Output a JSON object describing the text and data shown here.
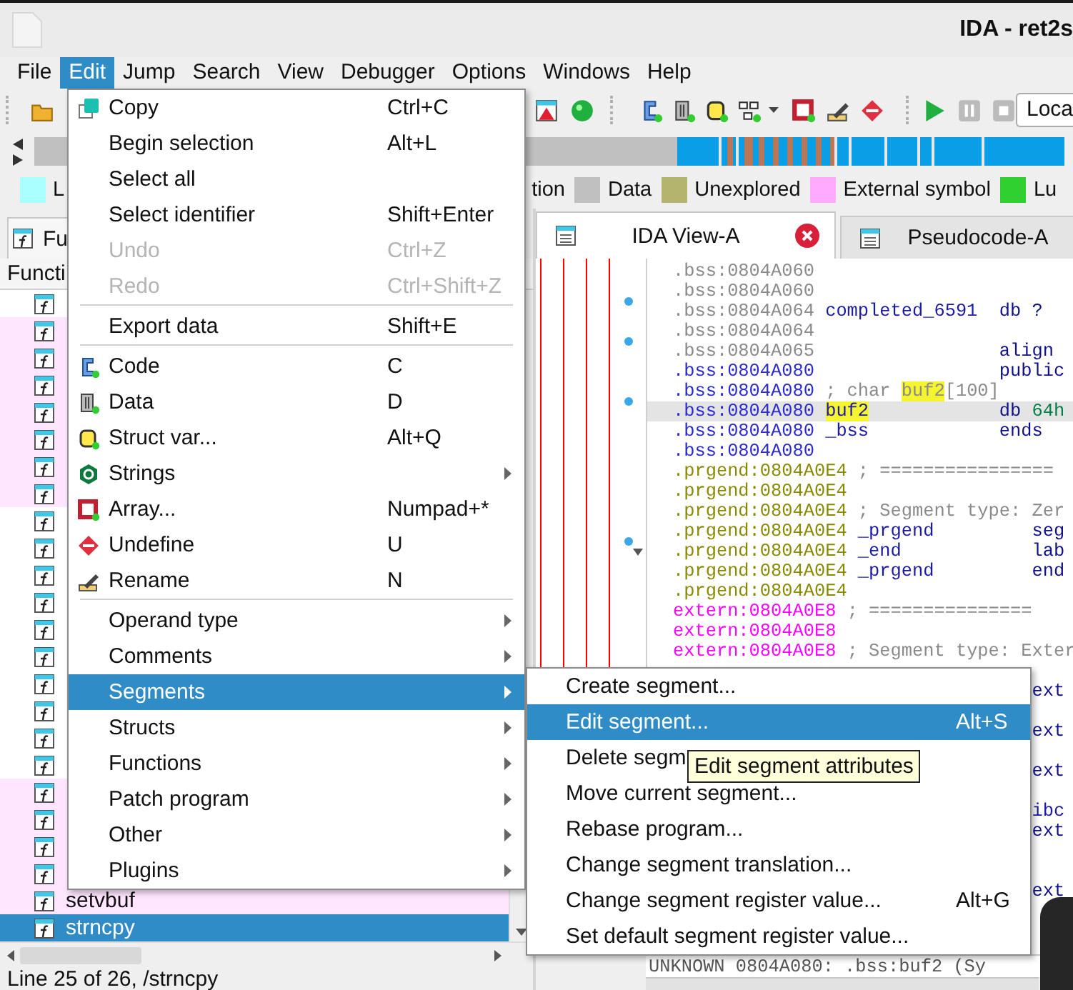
{
  "window": {
    "title": "IDA - ret2s"
  },
  "menubar": [
    {
      "label": "File",
      "selected": false
    },
    {
      "label": "Edit",
      "selected": true
    },
    {
      "label": "Jump",
      "selected": false
    },
    {
      "label": "Search",
      "selected": false
    },
    {
      "label": "View",
      "selected": false
    },
    {
      "label": "Debugger",
      "selected": false
    },
    {
      "label": "Options",
      "selected": false
    },
    {
      "label": "Windows",
      "selected": false
    },
    {
      "label": "Help",
      "selected": false
    }
  ],
  "toolbar": {
    "debugger_select": "Loca"
  },
  "legend": [
    {
      "label": "L",
      "color": "#aaffff"
    },
    {
      "label": "tion"
    },
    {
      "label": "Data",
      "color": "#c0c0c0"
    },
    {
      "label": "Unexplored",
      "color": "#b4b46e"
    },
    {
      "label": "External symbol",
      "color": "#ffaaff"
    },
    {
      "label": "Lu",
      "color": "#30d030"
    }
  ],
  "functions_panel": {
    "tab": "Fu",
    "header": "Functi",
    "status": "Line 25 of 26, /strncpy",
    "rows": [
      {
        "imported": false,
        "selected": false
      },
      {
        "imported": true,
        "selected": false
      },
      {
        "imported": true,
        "selected": false
      },
      {
        "imported": true,
        "selected": false
      },
      {
        "imported": true,
        "selected": false
      },
      {
        "imported": true,
        "selected": false
      },
      {
        "imported": true,
        "selected": false
      },
      {
        "imported": true,
        "selected": false
      },
      {
        "imported": false,
        "selected": false
      },
      {
        "imported": false,
        "selected": false
      },
      {
        "imported": false,
        "selected": false
      },
      {
        "imported": false,
        "selected": false
      },
      {
        "imported": false,
        "selected": false
      },
      {
        "imported": false,
        "selected": false
      },
      {
        "imported": false,
        "selected": false
      },
      {
        "imported": false,
        "selected": false
      },
      {
        "imported": false,
        "selected": false
      },
      {
        "imported": false,
        "selected": false
      },
      {
        "imported": true,
        "selected": false
      },
      {
        "imported": true,
        "selected": false
      },
      {
        "imported": true,
        "selected": false
      },
      {
        "imported": true,
        "selected": false
      },
      {
        "name": "setvbuf",
        "imported": true,
        "selected": false
      },
      {
        "name": "strncpy",
        "imported": true,
        "selected": true
      }
    ]
  },
  "tabs": [
    {
      "label": "IDA View-A",
      "selected": true,
      "closable": true
    },
    {
      "label": "Pseudocode-A",
      "selected": false,
      "closable": false
    }
  ],
  "disassembly": {
    "status": "UNKNOWN 0804A080: .bss:buf2 (Sy",
    "lines": [
      {
        "kind": "bss",
        "address": ".bss:0804A060",
        "color": "#8a8a8a",
        "selected": false,
        "dot": false
      },
      {
        "kind": "bss",
        "address": ".bss:0804A060",
        "color": "#8a8a8a",
        "selected": false,
        "dot": false
      },
      {
        "kind": "bss",
        "address": ".bss:0804A064",
        "color": "#8a8a8a",
        "selected": false,
        "dot": true,
        "tokens": [
          {
            "kind": "label",
            "text": "completed_6591",
            "highlight": false
          },
          {
            "kind": "mnemonic",
            "text": "db",
            "highlight": false
          },
          {
            "kind": "operand",
            "text": "?",
            "highlight": false
          }
        ]
      },
      {
        "kind": "bss",
        "address": ".bss:0804A064",
        "color": "#8a8a8a",
        "selected": false,
        "dot": false
      },
      {
        "kind": "bss",
        "address": ".bss:0804A065",
        "color": "#8a8a8a",
        "selected": false,
        "dot": true,
        "tokens": [
          {
            "kind": "mnemonic",
            "text": "align",
            "highlight": false
          }
        ]
      },
      {
        "kind": "bss",
        "address": ".bss:0804A080",
        "color": "#2a2ad0",
        "selected": false,
        "dot": false,
        "tokens": [
          {
            "kind": "mnemonic",
            "text": "public",
            "highlight": false
          }
        ]
      },
      {
        "kind": "bss",
        "address": ".bss:0804A080",
        "color": "#2a2ad0",
        "selected": false,
        "dot": false,
        "tokens": [
          {
            "kind": "comment",
            "text": "; char ",
            "highlight": false
          },
          {
            "kind": "comment",
            "text": "buf2",
            "highlight": true
          },
          {
            "kind": "comment",
            "text": "[100]",
            "highlight": false
          }
        ]
      },
      {
        "kind": "bss",
        "address": ".bss:0804A080",
        "color": "#2a2ad0",
        "selected": true,
        "dot": true,
        "tokens": [
          {
            "kind": "label",
            "text": "buf2",
            "highlight": true
          },
          {
            "kind": "mnemonic",
            "text": "db",
            "highlight": false
          },
          {
            "kind": "number",
            "text": "64h",
            "highlight": false
          }
        ]
      },
      {
        "kind": "bss",
        "address": ".bss:0804A080",
        "color": "#2a2ad0",
        "selected": false,
        "dot": false,
        "tokens": [
          {
            "kind": "label",
            "text": "_bss",
            "highlight": false
          },
          {
            "kind": "mnemonic",
            "text": "ends",
            "highlight": false
          }
        ]
      },
      {
        "kind": "bss",
        "address": ".bss:0804A080",
        "color": "#2a2ad0",
        "selected": false,
        "dot": false
      },
      {
        "kind": "prgend",
        "address": ".prgend:0804A0E4",
        "color": "#8a8a00",
        "selected": false,
        "dot": false,
        "tokens": [
          {
            "kind": "comment",
            "text": "; ================",
            "highlight": false
          }
        ]
      },
      {
        "kind": "prgend",
        "address": ".prgend:0804A0E4",
        "color": "#8a8a00",
        "selected": false,
        "dot": false
      },
      {
        "kind": "prgend",
        "address": ".prgend:0804A0E4",
        "color": "#8a8a00",
        "selected": false,
        "dot": false,
        "tokens": [
          {
            "kind": "comment",
            "text": "; Segment type: Zer",
            "highlight": false
          }
        ]
      },
      {
        "kind": "prgend",
        "address": ".prgend:0804A0E4",
        "color": "#8a8a00",
        "selected": false,
        "dot": false,
        "tokens": [
          {
            "kind": "label",
            "text": "_prgend",
            "highlight": false
          },
          {
            "kind": "mnemonic",
            "text": "seg",
            "highlight": false
          }
        ]
      },
      {
        "kind": "prgend",
        "address": ".prgend:0804A0E4",
        "color": "#8a8a00",
        "selected": false,
        "dot": true,
        "expanded": true,
        "tokens": [
          {
            "kind": "label",
            "text": "_end",
            "highlight": false
          },
          {
            "kind": "mnemonic",
            "text": "lab",
            "highlight": false
          }
        ]
      },
      {
        "kind": "prgend",
        "address": ".prgend:0804A0E4",
        "color": "#8a8a00",
        "selected": false,
        "dot": false,
        "tokens": [
          {
            "kind": "label",
            "text": "_prgend",
            "highlight": false
          },
          {
            "kind": "mnemonic",
            "text": "end",
            "highlight": false
          }
        ]
      },
      {
        "kind": "prgend",
        "address": ".prgend:0804A0E4",
        "color": "#8a8a00",
        "selected": false,
        "dot": false
      },
      {
        "kind": "extern",
        "address": "extern:0804A0E8",
        "color": "#ff00ff",
        "selected": false,
        "dot": false,
        "tokens": [
          {
            "kind": "comment",
            "text": "; ===============",
            "highlight": false
          }
        ]
      },
      {
        "kind": "extern",
        "address": "extern:0804A0E8",
        "color": "#ff00ff",
        "selected": false,
        "dot": false
      },
      {
        "kind": "extern",
        "address": "extern:0804A0E8",
        "color": "#ff00ff",
        "selected": false,
        "dot": false,
        "tokens": [
          {
            "kind": "comment",
            "text": "; Segment type: Exter",
            "highlight": false
          }
        ]
      },
      {
        "kind": "extern",
        "selected": false
      },
      {
        "kind": "extern",
        "selected": false,
        "tokens": [
          {
            "kind": "mnemonic",
            "text": "ext",
            "highlight": false
          }
        ]
      },
      {
        "kind": "extern",
        "selected": false
      },
      {
        "kind": "extern",
        "selected": false,
        "tokens": [
          {
            "kind": "mnemonic",
            "text": "ext",
            "highlight": false
          }
        ]
      },
      {
        "kind": "extern",
        "selected": false
      },
      {
        "kind": "extern",
        "selected": false,
        "tokens": [
          {
            "kind": "mnemonic",
            "text": "ext",
            "highlight": false
          }
        ]
      },
      {
        "kind": "extern",
        "selected": false
      },
      {
        "kind": "extern",
        "selected": false,
        "tokens": [
          {
            "kind": "label-tail",
            "text": "ibc",
            "highlight": false
          }
        ]
      },
      {
        "kind": "extern",
        "selected": false,
        "tokens": [
          {
            "kind": "mnemonic",
            "text": "ext",
            "highlight": false
          }
        ]
      },
      {
        "kind": "extern",
        "selected": false
      },
      {
        "kind": "extern",
        "selected": false
      },
      {
        "kind": "extern",
        "selected": false,
        "tokens": [
          {
            "kind": "mnemonic",
            "text": "ext",
            "highlight": false
          }
        ]
      }
    ]
  },
  "edit_menu": {
    "items": [
      {
        "kind": "item",
        "label": "Copy",
        "shortcut": "Ctrl+C",
        "disabled": false,
        "selected": false,
        "submenu": false
      },
      {
        "kind": "item",
        "label": "Begin selection",
        "shortcut": "Alt+L",
        "disabled": false,
        "selected": false,
        "submenu": false
      },
      {
        "kind": "item",
        "label": "Select all",
        "disabled": false,
        "selected": false,
        "submenu": false
      },
      {
        "kind": "item",
        "label": "Select identifier",
        "shortcut": "Shift+Enter",
        "disabled": false,
        "selected": false,
        "submenu": false
      },
      {
        "kind": "item",
        "label": "Undo",
        "shortcut": "Ctrl+Z",
        "disabled": true,
        "selected": false,
        "submenu": false
      },
      {
        "kind": "item",
        "label": "Redo",
        "shortcut": "Ctrl+Shift+Z",
        "disabled": true,
        "selected": false,
        "submenu": false
      },
      {
        "kind": "separator"
      },
      {
        "kind": "item",
        "label": "Export data",
        "shortcut": "Shift+E",
        "disabled": false,
        "selected": false,
        "submenu": false
      },
      {
        "kind": "separator"
      },
      {
        "kind": "item",
        "label": "Code",
        "shortcut": "C",
        "disabled": false,
        "selected": false,
        "submenu": false
      },
      {
        "kind": "item",
        "label": "Data",
        "shortcut": "D",
        "disabled": false,
        "selected": false,
        "submenu": false
      },
      {
        "kind": "item",
        "label": "Struct var...",
        "shortcut": "Alt+Q",
        "disabled": false,
        "selected": false,
        "submenu": false
      },
      {
        "kind": "item",
        "label": "Strings",
        "disabled": false,
        "selected": false,
        "submenu": true
      },
      {
        "kind": "item",
        "label": "Array...",
        "shortcut": "Numpad+*",
        "disabled": false,
        "selected": false,
        "submenu": false
      },
      {
        "kind": "item",
        "label": "Undefine",
        "shortcut": "U",
        "disabled": false,
        "selected": false,
        "submenu": false
      },
      {
        "kind": "item",
        "label": "Rename",
        "shortcut": "N",
        "disabled": false,
        "selected": false,
        "submenu": false
      },
      {
        "kind": "separator"
      },
      {
        "kind": "item",
        "label": "Operand type",
        "disabled": false,
        "selected": false,
        "submenu": true
      },
      {
        "kind": "item",
        "label": "Comments",
        "disabled": false,
        "selected": false,
        "submenu": true
      },
      {
        "kind": "item",
        "label": "Segments",
        "disabled": false,
        "selected": true,
        "submenu": true
      },
      {
        "kind": "item",
        "label": "Structs",
        "disabled": false,
        "selected": false,
        "submenu": true
      },
      {
        "kind": "item",
        "label": "Functions",
        "disabled": false,
        "selected": false,
        "submenu": true
      },
      {
        "kind": "item",
        "label": "Patch program",
        "disabled": false,
        "selected": false,
        "submenu": true
      },
      {
        "kind": "item",
        "label": "Other",
        "disabled": false,
        "selected": false,
        "submenu": true
      },
      {
        "kind": "item",
        "label": "Plugins",
        "disabled": false,
        "selected": false,
        "submenu": true
      }
    ]
  },
  "segments_menu": {
    "items": [
      {
        "kind": "item",
        "label": "Create segment...",
        "disabled": false,
        "selected": false,
        "submenu": false
      },
      {
        "kind": "item",
        "label": "Edit segment...",
        "shortcut": "Alt+S",
        "disabled": false,
        "selected": true,
        "submenu": false
      },
      {
        "kind": "item",
        "label": "Delete segm",
        "disabled": false,
        "selected": false,
        "submenu": false
      },
      {
        "kind": "item",
        "label": "Move current segment...",
        "disabled": false,
        "selected": false,
        "submenu": false
      },
      {
        "kind": "item",
        "label": "Rebase program...",
        "disabled": false,
        "selected": false,
        "submenu": false
      },
      {
        "kind": "item",
        "label": "Change segment translation...",
        "disabled": false,
        "selected": false,
        "submenu": false
      },
      {
        "kind": "item",
        "label": "Change segment register value...",
        "shortcut": "Alt+G",
        "disabled": false,
        "selected": false,
        "submenu": false
      },
      {
        "kind": "item",
        "label": "Set default segment register value...",
        "disabled": false,
        "selected": false,
        "submenu": false
      }
    ]
  },
  "tooltip": {
    "text": "Edit segment attributes"
  }
}
